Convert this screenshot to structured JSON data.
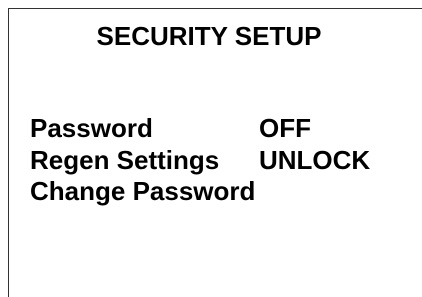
{
  "screen": {
    "title": "SECURITY SETUP",
    "menu": [
      {
        "label": "Password",
        "value": "OFF"
      },
      {
        "label": "Regen Settings",
        "value": "UNLOCK"
      },
      {
        "label": "Change Password",
        "value": ""
      }
    ]
  },
  "colors": {
    "background": "#ffffff",
    "text": "#000000",
    "border": "#333333"
  }
}
